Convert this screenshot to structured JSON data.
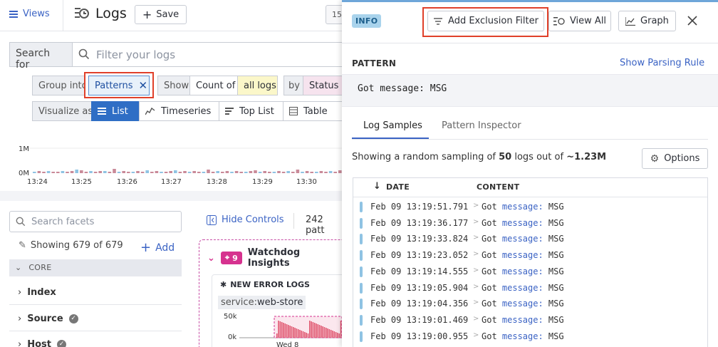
{
  "left": {
    "views_label": "Views",
    "title": "Logs",
    "save_label": "Save",
    "time_chip": "15",
    "search_for_label": "Search for",
    "search_placeholder": "Filter your logs",
    "group_into_label": "Group into",
    "group_value": "Patterns",
    "show_label": "Show",
    "count_of_label": "Count of",
    "all_logs_label": "all logs",
    "by_label": "by",
    "status_label": "Status",
    "visualize_as_label": "Visualize as",
    "viz_options": [
      "List",
      "Timeseries",
      "Top List",
      "Table"
    ],
    "viz_selected": "List",
    "chart": {
      "y_ticks": [
        "1M",
        "0M"
      ],
      "x_ticks": [
        "13:24",
        "13:25",
        "13:26",
        "13:27",
        "13:28",
        "13:29",
        "13:30"
      ]
    },
    "facets_placeholder": "Search facets",
    "showing_text": "Showing 679 of 679",
    "add_label": "Add",
    "core_label": "CORE",
    "facets": [
      "Index",
      "Source",
      "Host"
    ],
    "hide_controls_label": "Hide Controls",
    "pattern_count": "242 patt",
    "watchdog": {
      "badge_count": "9",
      "title": "Watchdog Insights",
      "card_title": "NEW ERROR LOGS",
      "service_key": "service:",
      "service_value": "web-store",
      "y_ticks": [
        "50k",
        "0k"
      ],
      "x_tick": "Wed 8"
    }
  },
  "panel": {
    "info_badge": "INFO",
    "add_exclusion_label": "Add Exclusion Filter",
    "view_all_label": "View All",
    "graph_label": "Graph",
    "pattern_heading": "PATTERN",
    "show_parsing_label": "Show Parsing Rule",
    "pattern_text": "Got message: MSG",
    "tabs": [
      "Log Samples",
      "Pattern Inspector"
    ],
    "sampling": {
      "prefix": "Showing a random sampling of ",
      "count": "50",
      "middle": " logs out of ",
      "total": "~1.23M"
    },
    "options_label": "Options",
    "table": {
      "col_date": "DATE",
      "col_content": "CONTENT",
      "rows": [
        {
          "date": "Feb 09 13:19:51.791",
          "prefix": "Got ",
          "key": "message:",
          "value": " MSG"
        },
        {
          "date": "Feb 09 13:19:36.177",
          "prefix": "Got ",
          "key": "message:",
          "value": " MSG"
        },
        {
          "date": "Feb 09 13:19:33.824",
          "prefix": "Got ",
          "key": "message:",
          "value": " MSG"
        },
        {
          "date": "Feb 09 13:19:23.052",
          "prefix": "Got ",
          "key": "message:",
          "value": " MSG"
        },
        {
          "date": "Feb 09 13:19:14.555",
          "prefix": "Got ",
          "key": "message:",
          "value": " MSG"
        },
        {
          "date": "Feb 09 13:19:05.904",
          "prefix": "Got ",
          "key": "message:",
          "value": " MSG"
        },
        {
          "date": "Feb 09 13:19:04.356",
          "prefix": "Got ",
          "key": "message:",
          "value": " MSG"
        },
        {
          "date": "Feb 09 13:19:01.469",
          "prefix": "Got ",
          "key": "message:",
          "value": " MSG"
        },
        {
          "date": "Feb 09 13:19:00.955",
          "prefix": "Got ",
          "key": "message:",
          "value": " MSG"
        }
      ]
    }
  },
  "colors": {
    "accent": "#3b63c4",
    "highlight": "#e0402a",
    "status_info": "#8fc3e3",
    "watchdog": "#d6328f"
  }
}
